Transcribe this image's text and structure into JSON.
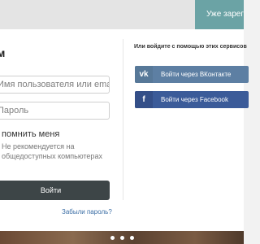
{
  "header": {
    "top_tab_label": "Уже зарегистрированы?"
  },
  "login": {
    "title": "м",
    "username_placeholder": "Имя пользователя или email-адрес",
    "password_placeholder": "Пароль",
    "remember_label": "помнить меня",
    "remember_note": "Не рекомендуется на общедоступных компьютерах",
    "submit_label": "Войти",
    "forgot_label": "Забыли пароль?"
  },
  "social": {
    "title": "Или войдите с помощью этих сервисов",
    "vk_label": "Войти через ВКонтакте",
    "vk_icon": "vk-icon",
    "fb_label": "Войти через Facebook",
    "fb_icon": "facebook-icon"
  },
  "colors": {
    "teal_tab": "#6ba3a5",
    "vk_button": "#5d7fa3",
    "fb_button": "#3b5b99",
    "login_button": "#3d4547",
    "link": "#3b6ea5"
  }
}
